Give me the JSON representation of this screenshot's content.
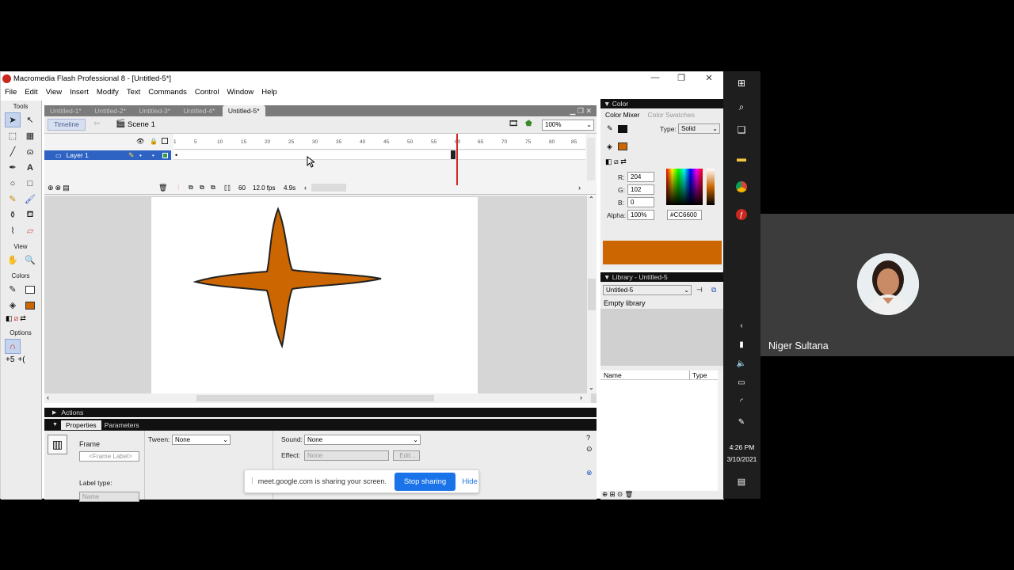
{
  "flash": {
    "title": "Macromedia Flash Professional 8 - [Untitled-5*]",
    "menu": [
      "File",
      "Edit",
      "View",
      "Insert",
      "Modify",
      "Text",
      "Commands",
      "Control",
      "Window",
      "Help"
    ],
    "tools_label": "Tools",
    "view_label": "View",
    "colors_label": "Colors",
    "options_label": "Options",
    "doc_tabs": [
      "Untitled-1*",
      "Untitled-2*",
      "Untitled-3*",
      "Untitled-4*",
      "Untitled-5*"
    ],
    "timeline_button": "Timeline",
    "scene": "Scene 1",
    "zoom": "100%",
    "layer": "Layer 1",
    "ruler_ticks": [
      "1",
      "5",
      "10",
      "15",
      "20",
      "25",
      "30",
      "35",
      "40",
      "45",
      "50",
      "55",
      "60",
      "65",
      "70",
      "75",
      "80",
      "85"
    ],
    "current_frame": "60",
    "fps": "12.0 fps",
    "time": "4.9s",
    "actions": "Actions",
    "props_tabs": [
      "Properties",
      "Parameters"
    ],
    "frame_label": "Frame",
    "frame_label_placeholder": "<Frame Label>",
    "tween_label": "Tween:",
    "tween_value": "None",
    "sound_label": "Sound:",
    "sound_value": "None",
    "effect_label": "Effect:",
    "effect_value": "None",
    "edit_label": "Edit...",
    "label_type_label": "Label type:",
    "label_type_value": "Name",
    "shape_fill": "#CC6600"
  },
  "color_panel": {
    "title": "Color",
    "tabs": [
      "Color Mixer",
      "Color Swatches"
    ],
    "type_label": "Type:",
    "type_value": "Solid",
    "r_label": "R:",
    "r_value": "204",
    "g_label": "G:",
    "g_value": "102",
    "b_label": "B:",
    "b_value": "0",
    "alpha_label": "Alpha:",
    "alpha_value": "100%",
    "hex": "#CC6600"
  },
  "library": {
    "title": "Library - Untitled-5",
    "select_value": "Untitled-5",
    "empty": "Empty library",
    "col_name": "Name",
    "col_type": "Type"
  },
  "taskbar": {
    "time": "4:26 PM",
    "date": "3/10/2021"
  },
  "meet": {
    "participant_name": "Niger Sultana",
    "banner_text": "meet.google.com is sharing your screen.",
    "stop_button": "Stop sharing",
    "hide_button": "Hide"
  }
}
